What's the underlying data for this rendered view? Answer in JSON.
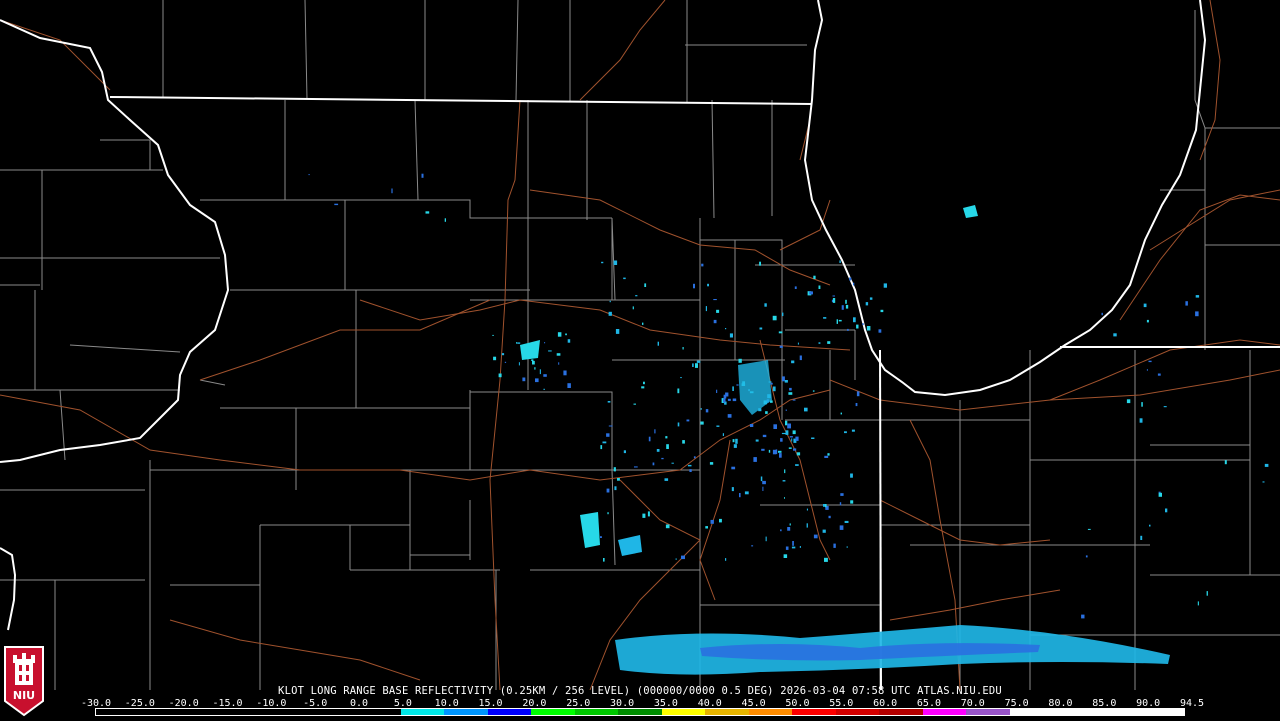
{
  "product": {
    "caption": "KLOT LONG RANGE BASE REFLECTIVITY (0.25KM / 256 LEVEL) (000000/0000 0.5 DEG) 2026-03-04 07:58 UTC  ATLAS.NIU.EDU"
  },
  "legend": {
    "ticks": [
      "-30.0",
      "-25.0",
      "-20.0",
      "-15.0",
      "-10.0",
      "-5.0",
      "0.0",
      "5.0",
      "10.0",
      "15.0",
      "20.0",
      "25.0",
      "30.0",
      "35.0",
      "40.0",
      "45.0",
      "50.0",
      "55.0",
      "60.0",
      "65.0",
      "70.0",
      "75.0",
      "80.0",
      "85.0",
      "90.0",
      "94.5"
    ],
    "segment_colors": [
      "#000000",
      "#000000",
      "#000000",
      "#000000",
      "#000000",
      "#000000",
      "#000000",
      "#00e6e6",
      "#0096ff",
      "#0000ff",
      "#00ff00",
      "#00c800",
      "#008c00",
      "#ffff00",
      "#e6b400",
      "#ff8c00",
      "#ff0000",
      "#d40000",
      "#b40000",
      "#ff00ff",
      "#9955c9",
      "#ffffff",
      "#ffffff",
      "#ffffff",
      "#ffffff"
    ]
  },
  "logo": {
    "text": "NIU"
  },
  "colors": {
    "state_line": "#ffffff",
    "county_line": "#8a8a8a",
    "highway": "#a0522d",
    "echo_light": "#1fb6e6",
    "echo_cyan": "#27d8e8",
    "echo_blue": "#2a70e0",
    "logo_red": "#c8102e"
  }
}
